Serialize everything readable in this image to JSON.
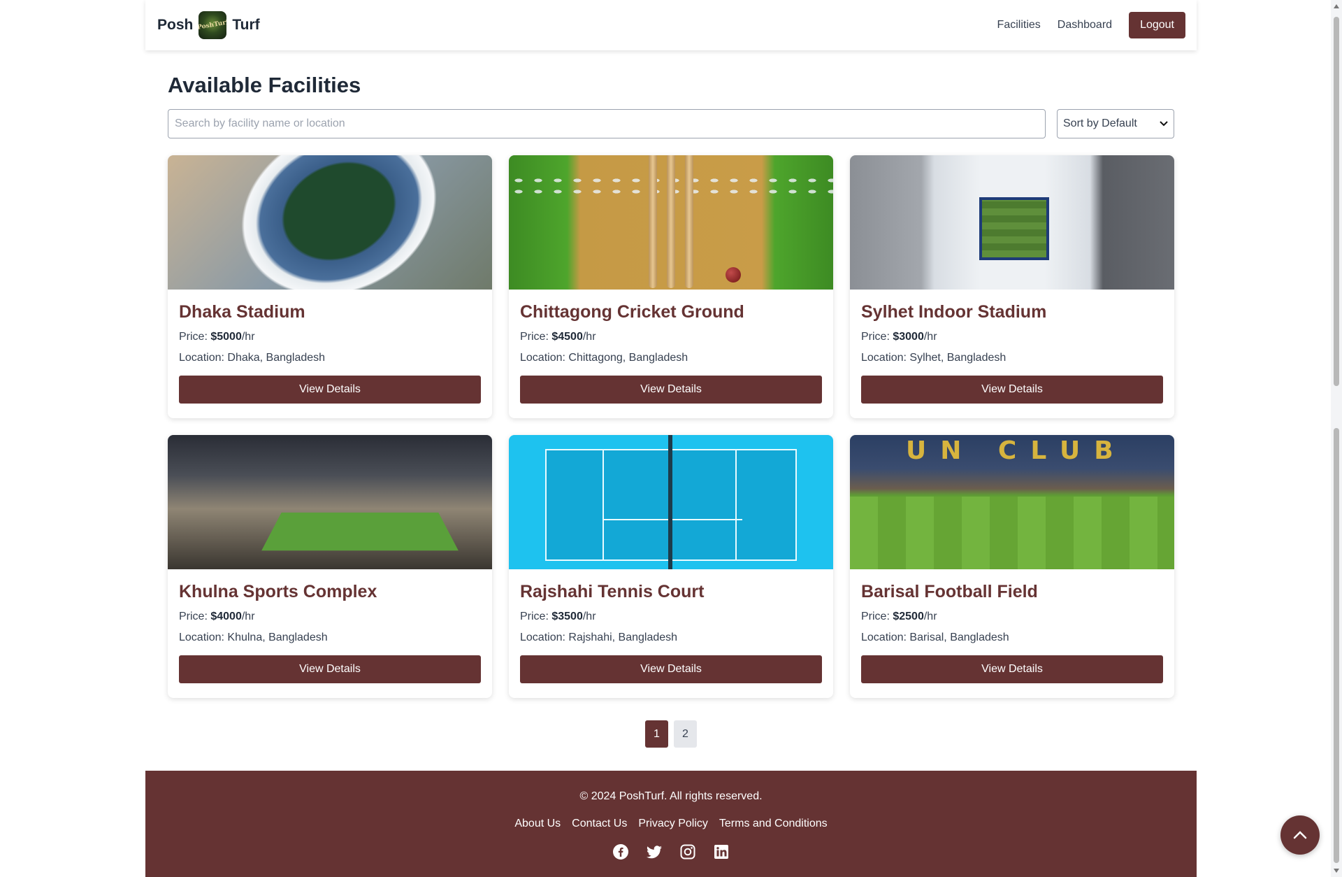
{
  "navbar": {
    "brand_left": "Posh",
    "brand_logo_text": "PoshTurf",
    "brand_right": "Turf",
    "links": [
      "Facilities",
      "Dashboard"
    ],
    "logout_label": "Logout"
  },
  "main": {
    "title": "Available Facilities",
    "search_placeholder": "Search by facility name or location",
    "sort_value": "Sort by Default",
    "price_label": "Price: ",
    "location_label": "Location: ",
    "button_label": "View Details",
    "facilities": [
      {
        "name": "Dhaka Stadium",
        "price": "$5000",
        "unit": "/hr",
        "location": "Dhaka, Bangladesh"
      },
      {
        "name": "Chittagong Cricket Ground",
        "price": "$4500",
        "unit": "/hr",
        "location": "Chittagong, Bangladesh"
      },
      {
        "name": "Sylhet Indoor Stadium",
        "price": "$3000",
        "unit": "/hr",
        "location": "Sylhet, Bangladesh"
      },
      {
        "name": "Khulna Sports Complex",
        "price": "$4000",
        "unit": "/hr",
        "location": "Khulna, Bangladesh"
      },
      {
        "name": "Rajshahi Tennis Court",
        "price": "$3500",
        "unit": "/hr",
        "location": "Rajshahi, Bangladesh"
      },
      {
        "name": "Barisal Football Field",
        "price": "$2500",
        "unit": "/hr",
        "location": "Barisal, Bangladesh"
      }
    ],
    "barisal_sign": "UN CLUB"
  },
  "pagination": {
    "pages": [
      "1",
      "2"
    ],
    "active": "1"
  },
  "footer": {
    "copyright": "© 2024 PoshTurf. All rights reserved.",
    "links": [
      "About Us",
      "Contact Us",
      "Privacy Policy",
      "Terms and Conditions"
    ],
    "socials": [
      "facebook-icon",
      "twitter-icon",
      "instagram-icon",
      "linkedin-icon"
    ]
  },
  "colors": {
    "accent": "#653333",
    "text": "#1f2937"
  }
}
